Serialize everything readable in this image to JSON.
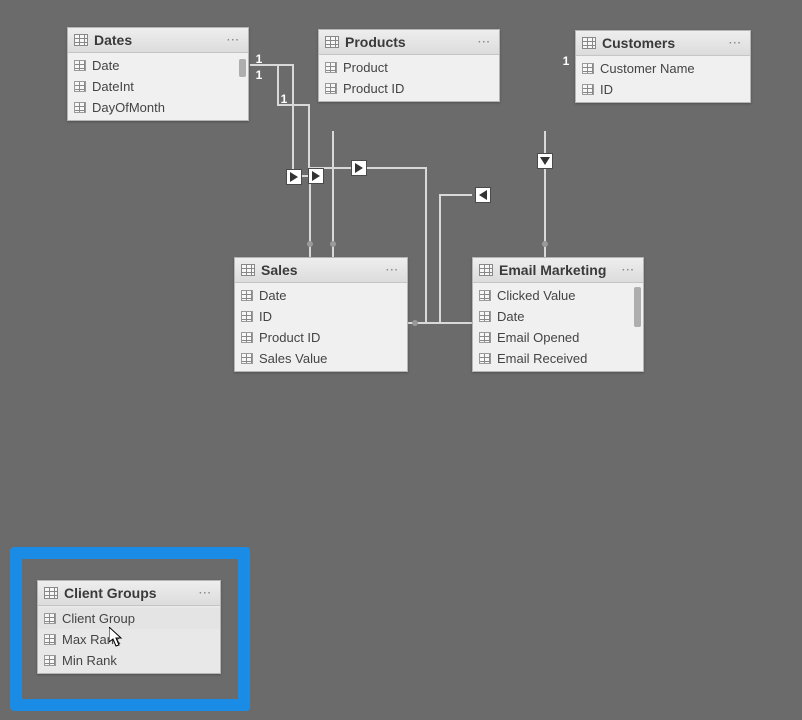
{
  "glyphs": {
    "one": "1",
    "more": "···"
  },
  "tables": {
    "dates": {
      "title": "Dates",
      "fields": [
        "Date",
        "DateInt",
        "DayOfMonth"
      ]
    },
    "products": {
      "title": "Products",
      "fields": [
        "Product",
        "Product ID"
      ]
    },
    "customers": {
      "title": "Customers",
      "fields": [
        "Customer Name",
        "ID"
      ]
    },
    "sales": {
      "title": "Sales",
      "fields": [
        "Date",
        "ID",
        "Product ID",
        "Sales Value"
      ]
    },
    "email_marketing": {
      "title": "Email Marketing",
      "fields": [
        "Clicked Value",
        "Date",
        "Email Opened",
        "Email Received"
      ]
    },
    "client_groups": {
      "title": "Client Groups",
      "fields": [
        "Client Group",
        "Max Rank",
        "Min Rank"
      ]
    }
  },
  "chart_data": {
    "type": "table",
    "description": "Entity relationship diagram showing tables and relationships",
    "entities": [
      {
        "name": "Dates",
        "columns": [
          "Date",
          "DateInt",
          "DayOfMonth"
        ]
      },
      {
        "name": "Products",
        "columns": [
          "Product",
          "Product ID"
        ]
      },
      {
        "name": "Customers",
        "columns": [
          "Customer Name",
          "ID"
        ]
      },
      {
        "name": "Sales",
        "columns": [
          "Date",
          "ID",
          "Product ID",
          "Sales Value"
        ]
      },
      {
        "name": "Email Marketing",
        "columns": [
          "Clicked Value",
          "Date",
          "Email Opened",
          "Email Received"
        ]
      },
      {
        "name": "Client Groups",
        "columns": [
          "Client Group",
          "Max Rank",
          "Min Rank"
        ]
      }
    ],
    "relationships": [
      {
        "from": "Dates",
        "to": "Sales",
        "from_card": "1",
        "to_card": "*"
      },
      {
        "from": "Dates",
        "to": "Email Marketing",
        "from_card": "1",
        "to_card": "*"
      },
      {
        "from": "Products",
        "to": "Sales",
        "from_card": "1",
        "to_card": "*"
      },
      {
        "from": "Customers",
        "to": "Email Marketing",
        "from_card": "1",
        "to_card": "*"
      },
      {
        "from": "Sales",
        "to": "Email Marketing",
        "from_card": "*",
        "to_card": "*"
      }
    ],
    "selected_entity": "Client Groups"
  }
}
